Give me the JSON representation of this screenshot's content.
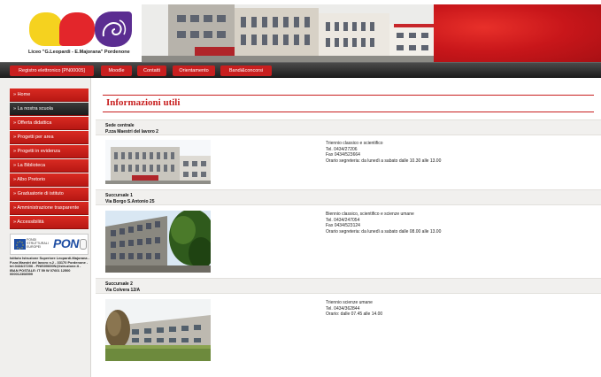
{
  "header": {
    "school_name": "Liceo \"G.Leopardi - E.Majorana\" Pordenone"
  },
  "nav": {
    "items": [
      {
        "label": "Registro elettronico [PN00005]"
      },
      {
        "label": "Moodle"
      },
      {
        "label": "Contatti"
      },
      {
        "label": "Orientamento"
      },
      {
        "label": "Bandi&concorsi"
      }
    ],
    "accent_color": "#c81f1f"
  },
  "sidebar": {
    "items": [
      {
        "label": "» Home"
      },
      {
        "label": "» La nostra scuola"
      },
      {
        "label": "» Offerta didattica"
      },
      {
        "label": "» Progetti per area"
      },
      {
        "label": "» Progetti in evidenza"
      },
      {
        "label": "» La Biblioteca"
      },
      {
        "label": "» Albo Pretorio"
      },
      {
        "label": "» Graduatorie di istituto"
      },
      {
        "label": "» Amministrazione trasparente"
      },
      {
        "label": "» Accessibilità"
      }
    ],
    "active_index": 1,
    "banner": {
      "fse_text": "FONDI STRUTTURALI EUROPEI",
      "pon_text": "PON"
    },
    "school_info": "Istituto Istruzione Superiore Leopardi-Majorana - P.zza Maestri del lavoro n.2 - 33170 Pordenone - tel.0434/27206 - PNIS00600N@istruzione.it - IBAN POSTALE: IT 59 W 07601 12500 000012308599"
  },
  "main": {
    "title": "Informazioni utili",
    "sedi": [
      {
        "name": "Sede centrale",
        "address": "P.zza Maestri del lavoro 2",
        "lines": [
          "Triennio classico e scientifico",
          "Tel. 0434/27206",
          "Fax 0434/523664",
          "Orario segreteria: da lunedì a sabato dalle 10.30 alle 13.00"
        ]
      },
      {
        "name": "Succursale 1",
        "address": "Via Borgo S.Antonio 25",
        "lines": [
          "Biennio classico, scientifico e scienze umane",
          "Tel. 0434/247054",
          "Fax 0434/523124",
          "Orario segreteria: da lunedì a sabato dalle 08.00 alle 13.00"
        ]
      },
      {
        "name": "Succursale 2",
        "address": "Via Colvera 12/A",
        "lines": [
          "Triennio scienze umane",
          "Tel. 0434/362844",
          "Orario: dalle 07.45 alle 14.00"
        ]
      }
    ]
  }
}
